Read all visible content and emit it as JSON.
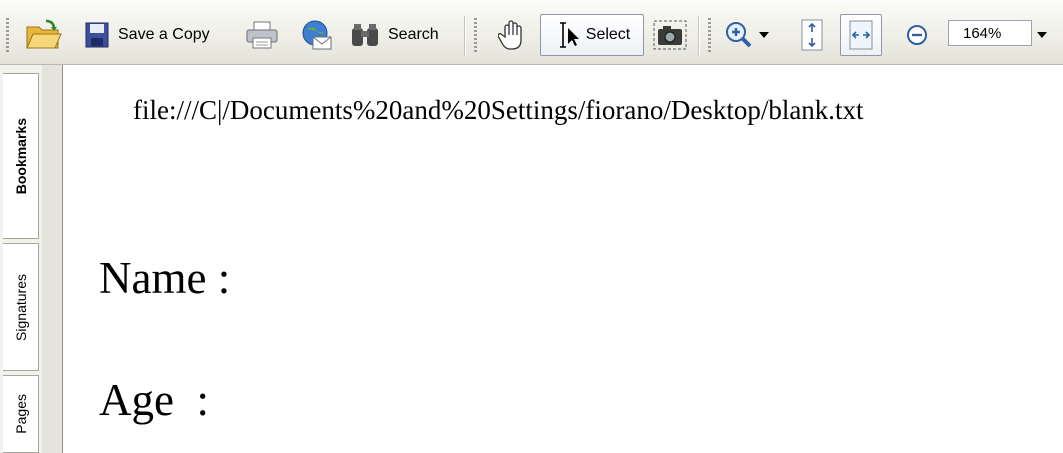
{
  "toolbar": {
    "save_copy_label": "Save a Copy",
    "search_label": "Search",
    "select_label": "Select",
    "zoom_value": "164%"
  },
  "sidebar": {
    "tabs": [
      "Bookmarks",
      "Signatures",
      "Pages"
    ],
    "active_tab": "Bookmarks"
  },
  "document": {
    "header_url": "file:///C|/Documents%20and%20Settings/fiorano/Desktop/blank.txt",
    "lines": [
      "Name :",
      "Age  :"
    ]
  },
  "colors": {
    "toolbar_bg": "#eeeee6",
    "document_bg": "#ffffff",
    "accent": "#2f6fce"
  },
  "icons": [
    "open-folder-icon",
    "save-disk-icon",
    "print-icon",
    "email-globe-icon",
    "binoculars-icon",
    "hand-icon",
    "select-cursor-icon",
    "snapshot-camera-icon",
    "zoom-in-icon",
    "dropdown-arrow-icon",
    "fit-page-icon",
    "fit-width-icon",
    "zoom-out-icon"
  ]
}
